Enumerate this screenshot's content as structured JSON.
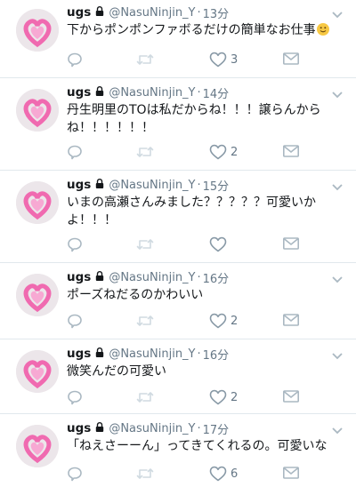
{
  "tweets": [
    {
      "name": "ugs",
      "handle": "@NasuNinjin_Y",
      "separator": "·",
      "time": "13分",
      "text": "下からポンポンファボるだけの簡単なお仕事",
      "emoji": "smiling-face-emoji",
      "likes": "3"
    },
    {
      "name": "ugs",
      "handle": "@NasuNinjin_Y",
      "separator": "·",
      "time": "14分",
      "text": "丹生明里のTOは私だからね！！！譲らんからね！！！！！！",
      "likes": "2"
    },
    {
      "name": "ugs",
      "handle": "@NasuNinjin_Y",
      "separator": "·",
      "time": "15分",
      "text": "いまの高瀬さんみました？？？？？可愛いかよ！！！",
      "likes": ""
    },
    {
      "name": "ugs",
      "handle": "@NasuNinjin_Y",
      "separator": "·",
      "time": "16分",
      "text": "ポーズねだるのかわいい",
      "likes": "2"
    },
    {
      "name": "ugs",
      "handle": "@NasuNinjin_Y",
      "separator": "·",
      "time": "16分",
      "text": "微笑んだの可愛い",
      "likes": "2"
    },
    {
      "name": "ugs",
      "handle": "@NasuNinjin_Y",
      "separator": "·",
      "time": "17分",
      "text": "「ねえさーーん」ってきてくれるの。可愛いな",
      "likes": "6"
    }
  ],
  "colors": {
    "icon_gray": "#aab8c2",
    "meta_gray": "#657786",
    "avatar_pink": "#f06ab0"
  },
  "icons": [
    "reply-icon",
    "retweet-icon",
    "like-icon",
    "dm-icon",
    "lock-icon",
    "chevron-down-icon"
  ]
}
